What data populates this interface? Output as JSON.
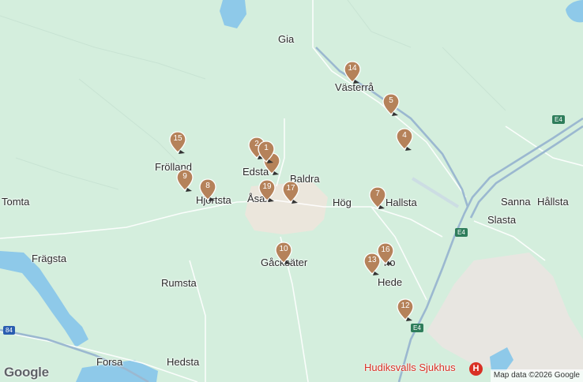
{
  "map": {
    "places": [
      {
        "id": "gia",
        "name": "Gia"
      },
      {
        "id": "vasterra",
        "name": "Västerrå"
      },
      {
        "id": "frolland",
        "name": "Frölland"
      },
      {
        "id": "edsta",
        "name": "Edsta"
      },
      {
        "id": "baldra",
        "name": "Baldra"
      },
      {
        "id": "tomta",
        "name": "Tomta"
      },
      {
        "id": "hjortsta",
        "name": "Hjortsta"
      },
      {
        "id": "asax",
        "name": "Åsax"
      },
      {
        "id": "hog",
        "name": "Hög"
      },
      {
        "id": "hallsta",
        "name": "Hallsta"
      },
      {
        "id": "sanna",
        "name": "Sanna"
      },
      {
        "id": "hallsta2",
        "name": "Hållsta"
      },
      {
        "id": "slasta",
        "name": "Slasta"
      },
      {
        "id": "fragsta",
        "name": "Frägsta"
      },
      {
        "id": "gacksater",
        "name": "Gåcksäter"
      },
      {
        "id": "hirlo",
        "name": "rlo"
      },
      {
        "id": "hede",
        "name": "Hede"
      },
      {
        "id": "rumsta",
        "name": "Rumsta"
      },
      {
        "id": "forsa",
        "name": "Forsa"
      },
      {
        "id": "hedsta",
        "name": "Hedsta"
      }
    ],
    "markers": [
      {
        "id": "m14",
        "label": "14"
      },
      {
        "id": "m5",
        "label": "5"
      },
      {
        "id": "m4",
        "label": "4"
      },
      {
        "id": "m15",
        "label": "15"
      },
      {
        "id": "m2",
        "label": "2"
      },
      {
        "id": "m1",
        "label": "1"
      },
      {
        "id": "m3",
        "label": ""
      },
      {
        "id": "m9",
        "label": "9"
      },
      {
        "id": "m8",
        "label": "8"
      },
      {
        "id": "m19",
        "label": "19"
      },
      {
        "id": "m17",
        "label": "17"
      },
      {
        "id": "m7",
        "label": "7"
      },
      {
        "id": "m10",
        "label": "10"
      },
      {
        "id": "m16",
        "label": "16"
      },
      {
        "id": "m13",
        "label": "13"
      },
      {
        "id": "m12",
        "label": "12"
      }
    ],
    "road_shields": [
      "E4",
      "E4",
      "E4",
      "84"
    ],
    "hospital": {
      "name": "Hudiksvalls Sjukhus",
      "icon_letter": "H"
    },
    "attribution": "Map data ©2026 Google",
    "logo": "Google",
    "colors": {
      "land": "#d4eedd",
      "water": "#8ec9e9",
      "road_major": "#9bb8d0",
      "road_minor": "#ffffff",
      "marker": "#b5825a",
      "urban": "#e8e4dd"
    }
  }
}
